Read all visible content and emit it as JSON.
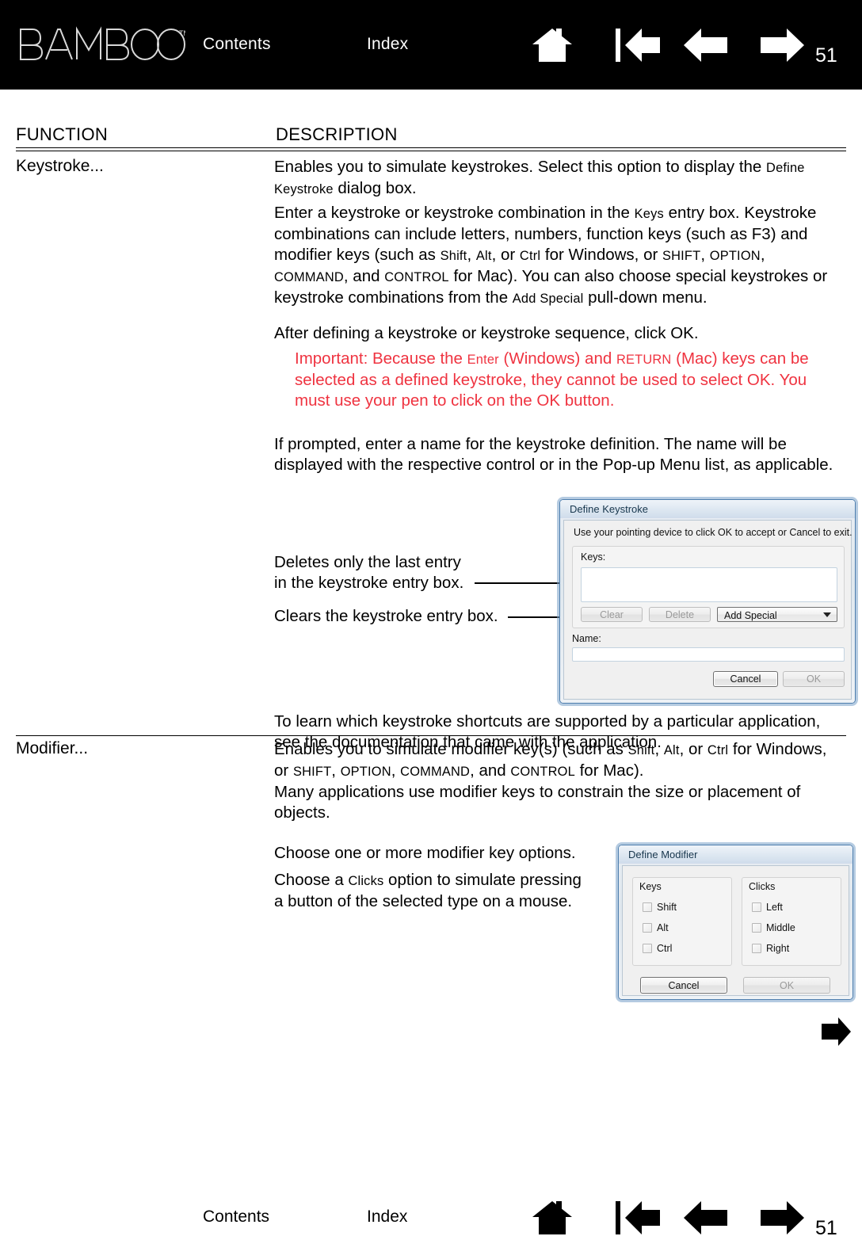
{
  "header": {
    "logo_text": "BAMBOO",
    "logo_tm": "™",
    "contents_label": "Contents",
    "index_label": "Index",
    "page_number": "51",
    "nav": [
      {
        "name": "home-icon",
        "label": "Home"
      },
      {
        "name": "first-page-icon",
        "label": "First page"
      },
      {
        "name": "previous-page-icon",
        "label": "Previous page"
      },
      {
        "name": "next-page-icon",
        "label": "Next page"
      }
    ]
  },
  "table": {
    "col_function": "FUNCTION",
    "col_description": "DESCRIPTION"
  },
  "keystroke": {
    "function_label": "Keystroke...",
    "p1_a": "Enables you to simulate keystrokes.  Select this option to display the ",
    "p1_b": "Define Keystroke",
    "p1_c": " dialog box.",
    "p2_a": "Enter a keystroke or keystroke combination in the ",
    "p2_keys": "Keys",
    "p2_b": " entry box. Keystroke combinations can include letters, numbers, function keys (such as F3) and modifier keys (such as ",
    "p2_shift": "Shift",
    "p2_c": ", ",
    "p2_alt": "Alt",
    "p2_d": ", or ",
    "p2_ctrl": "Ctrl",
    "p2_e": " for Windows, or ",
    "p2_shift2": "SHIFT",
    "p2_f": ", ",
    "p2_option": "OPTION",
    "p2_g": ", ",
    "p2_command": "COMMAND",
    "p2_h": ", and ",
    "p2_control": "CONTROL",
    "p2_i": " for Mac).  You can also choose special keystrokes or keystroke combinations from the ",
    "p2_addspecial": "Add Special",
    "p2_j": " pull-down menu.",
    "p3": "After defining a keystroke or keystroke sequence, click OK.",
    "red_a": "Important: Because the ",
    "red_enter": "Enter",
    "red_b": " (Windows) and ",
    "red_return": "RETURN",
    "red_c": " (Mac) keys can be selected as a defined keystroke, they cannot be used to select OK.  You must use your pen to click on the OK button.",
    "p4": "If prompted, enter a name for the keystroke definition.  The name will be displayed with the respective control or in the Pop-up Menu list, as applicable.",
    "callout_delete_line1": "Deletes only the last entry",
    "callout_delete_line2": "in the keystroke entry box.",
    "callout_clear": "Clears the keystroke entry box.",
    "p5": "To learn which keystroke shortcuts are supported by a particular application, see the documentation that came with the application."
  },
  "modifier": {
    "function_label": "Modifier...",
    "m1_a": "Enables you to simulate modifier key(s) (such as ",
    "m1_shift": "Shift",
    "m1_b": ", ",
    "m1_alt": "Alt",
    "m1_c": ", or ",
    "m1_ctrl": "Ctrl",
    "m1_d": " for Windows, or ",
    "m1_shift2": "SHIFT",
    "m1_e": ", ",
    "m1_option": "OPTION",
    "m1_f": ", ",
    "m1_command": "COMMAND",
    "m1_g": ", and ",
    "m1_control": "CONTROL",
    "m1_h": " for Mac).",
    "m1_i": "Many applications use modifier keys to constrain the size or placement of objects.",
    "m2": "Choose one or more modifier key options.",
    "m3_a": "Choose a ",
    "m3_clicks": "Clicks",
    "m3_b": " option to simulate pressing a button of the selected type on a mouse."
  },
  "define_keystroke_dialog": {
    "title": "Define Keystroke",
    "instruction": "Use your pointing device to click OK to accept or Cancel to exit.",
    "keys_label": "Keys:",
    "keys_value": "",
    "clear_button": "Clear",
    "delete_button": "Delete",
    "add_special_label": "Add Special",
    "name_label": "Name:",
    "name_value": "",
    "cancel_button": "Cancel",
    "ok_button": "OK"
  },
  "define_modifier_dialog": {
    "title": "Define Modifier",
    "keys_group": "Keys",
    "clicks_group": "Clicks",
    "keys_options": [
      "Shift",
      "Alt",
      "Ctrl"
    ],
    "clicks_options": [
      "Left",
      "Middle",
      "Right"
    ],
    "cancel_button": "Cancel",
    "ok_button": "OK"
  },
  "footer": {
    "contents_label": "Contents",
    "index_label": "Index",
    "page_number": "51"
  },
  "colors": {
    "header_bg": "#000000",
    "warning_red": "#ef3340",
    "dialog_border_blue": "#4f7fae",
    "dialog_bg": "#f0f0f0"
  }
}
